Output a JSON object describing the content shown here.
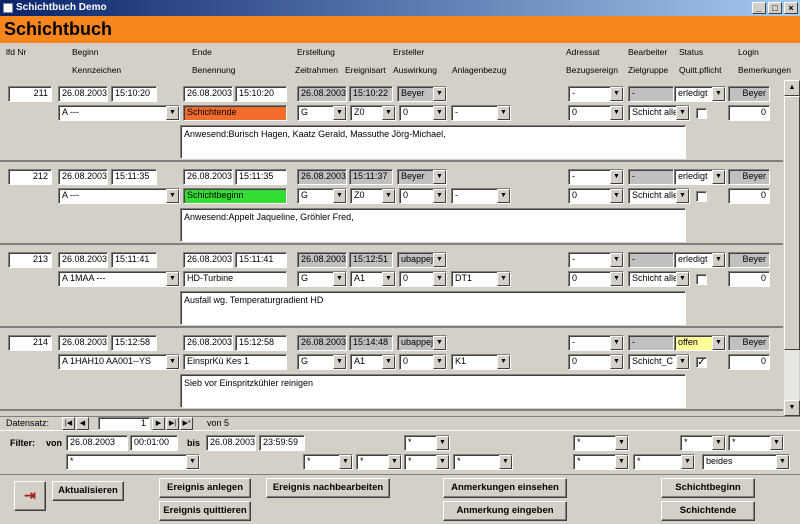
{
  "window": {
    "title": "Schichtbuch Demo"
  },
  "banner": {
    "title": "Schichtbuch"
  },
  "headers": {
    "row1": [
      "lfd Nr",
      "Beginn",
      "Ende",
      "Erstellung",
      "Ersteller",
      "Adressat",
      "Bearbeiter",
      "Status",
      "Login"
    ],
    "row2": [
      "Kennzeichen",
      "Benennung",
      "Zeitrahmen",
      "Ereignisart",
      "Auswirkung",
      "Anlagenbezug",
      "Bezugsereign",
      "Zielgruppe",
      "Quitt.pflicht",
      "Bemerkungen"
    ]
  },
  "records": [
    {
      "nr": "211",
      "beginn_date": "26.08.2003",
      "beginn_time": "15:10:20",
      "ende_date": "26.08.2003",
      "ende_time": "15:10:20",
      "erst_date": "26.08.2003",
      "erst_time": "15:10:22",
      "ersteller": "Beyer",
      "adressat": "-",
      "bearbeiter": "-",
      "status": "erledigt",
      "login": "Beyer",
      "kennzeichen": "A ---",
      "benennung": "Schichtende",
      "zeitrahmen": "G",
      "ereignisart": "Z0",
      "auswirkung": "0",
      "anlagenbezug": "-",
      "bezugsereign": "0",
      "zielgruppe": "Schicht alle",
      "quitt": "",
      "bemerkungen": "0",
      "memo": "Anwesend:Burisch Hagen, Kaatz Gerald, Massuthe Jörg-Michael,",
      "ben_color": "#f46c2c"
    },
    {
      "nr": "212",
      "beginn_date": "26.08.2003",
      "beginn_time": "15:11:35",
      "ende_date": "26.08.2003",
      "ende_time": "15:11:35",
      "erst_date": "26.08.2003",
      "erst_time": "15:11:37",
      "ersteller": "Beyer",
      "adressat": "-",
      "bearbeiter": "-",
      "status": "erledigt",
      "login": "Beyer",
      "kennzeichen": "A ---",
      "benennung": "Schichtbeginn",
      "zeitrahmen": "G",
      "ereignisart": "Z0",
      "auswirkung": "0",
      "anlagenbezug": "-",
      "bezugsereign": "0",
      "zielgruppe": "Schicht alle",
      "quitt": "",
      "bemerkungen": "0",
      "memo": "Anwesend:Appelt Jaqueline, Gröhler Fred,",
      "ben_color": "#33dd33"
    },
    {
      "nr": "213",
      "beginn_date": "26.08.2003",
      "beginn_time": "15:11:41",
      "ende_date": "26.08.2003",
      "ende_time": "15:11:41",
      "erst_date": "26.08.2003",
      "erst_time": "15:12:51",
      "ersteller": "ubappeje",
      "adressat": "-",
      "bearbeiter": "-",
      "status": "erledigt",
      "login": "Beyer",
      "kennzeichen": "A 1MAA ---",
      "benennung": "HD-Turbine",
      "zeitrahmen": "G",
      "ereignisart": "A1",
      "auswirkung": "0",
      "anlagenbezug": "DT1",
      "bezugsereign": "0",
      "zielgruppe": "Schicht alle",
      "quitt": "",
      "bemerkungen": "0",
      "memo": "Ausfall wg. Temperaturgradient HD",
      "ben_color": "#ffffff"
    },
    {
      "nr": "214",
      "beginn_date": "26.08.2003",
      "beginn_time": "15:12:58",
      "ende_date": "26.08.2003",
      "ende_time": "15:12:58",
      "erst_date": "26.08.2003",
      "erst_time": "15:14:48",
      "ersteller": "ubappeje",
      "adressat": "-",
      "bearbeiter": "-",
      "status": "offen",
      "login": "Beyer",
      "kennzeichen": "A 1HAH10 AA001--YS",
      "benennung": "EinsprKü Kes 1",
      "zeitrahmen": "G",
      "ereignisart": "A1",
      "auswirkung": "0",
      "anlagenbezug": "K1",
      "bezugsereign": "0",
      "zielgruppe": "Schicht_C",
      "quitt": "✓",
      "bemerkungen": "0",
      "memo": "Sieb vor Einspritzkühler reinigen",
      "ben_color": "#ffffff"
    }
  ],
  "nav": {
    "label": "Datensatz:",
    "current": "1",
    "of": "von 5"
  },
  "filter": {
    "label": "Filter:",
    "von": "von",
    "bis": "bis",
    "von_date": "26.08.2003",
    "von_time": "00:01:00",
    "bis_date": "26.08.2003",
    "bis_time": "23:59:59",
    "star": "*",
    "beides": "beides"
  },
  "buttons": {
    "aktualisieren": "Aktualisieren",
    "ereignis_anlegen": "Ereignis anlegen",
    "ereignis_quittieren": "Ereignis quittieren",
    "ereignis_nachbearbeiten": "Ereignis nachbearbeiten",
    "anmerkungen_einsehen": "Anmerkungen einsehen",
    "anmerkung_eingeben": "Anmerkung eingeben",
    "schichtbeginn": "Schichtbeginn",
    "schichtende": "Schichtende"
  },
  "colors": {
    "banner": "#f7871d",
    "titlebar": "#0a246a",
    "status_offen": "#ffff99"
  }
}
